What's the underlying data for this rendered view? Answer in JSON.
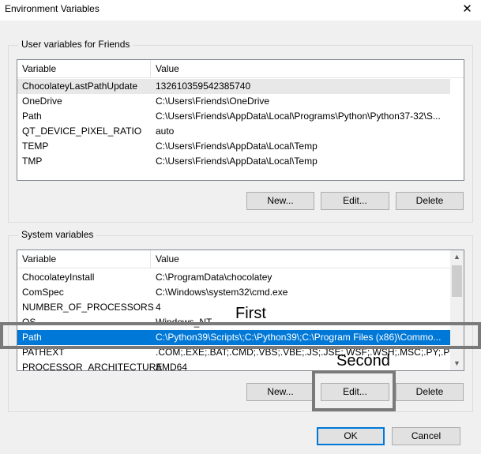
{
  "window": {
    "title": "Environment Variables",
    "close_glyph": "✕"
  },
  "user_vars": {
    "legend": "User variables for Friends",
    "headers": [
      "Variable",
      "Value"
    ],
    "rows": [
      [
        "ChocolateyLastPathUpdate",
        "132610359542385740"
      ],
      [
        "OneDrive",
        "C:\\Users\\Friends\\OneDrive"
      ],
      [
        "Path",
        "C:\\Users\\Friends\\AppData\\Local\\Programs\\Python\\Python37-32\\S..."
      ],
      [
        "QT_DEVICE_PIXEL_RATIO",
        "auto"
      ],
      [
        "TEMP",
        "C:\\Users\\Friends\\AppData\\Local\\Temp"
      ],
      [
        "TMP",
        "C:\\Users\\Friends\\AppData\\Local\\Temp"
      ]
    ],
    "buttons": {
      "new": "New...",
      "edit": "Edit...",
      "delete": "Delete"
    }
  },
  "system_vars": {
    "legend": "System variables",
    "headers": [
      "Variable",
      "Value"
    ],
    "rows": [
      [
        "ChocolateyInstall",
        "C:\\ProgramData\\chocolatey"
      ],
      [
        "ComSpec",
        "C:\\Windows\\system32\\cmd.exe"
      ],
      [
        "NUMBER_OF_PROCESSORS",
        "4"
      ],
      [
        "OS",
        "Windows_NT"
      ],
      [
        "Path",
        "C:\\Python39\\Scripts\\;C:\\Python39\\;C:\\Program Files (x86)\\Commo..."
      ],
      [
        "PATHEXT",
        ".COM;.EXE;.BAT;.CMD;.VBS;.VBE;.JS;.JSE;.WSF;.WSH;.MSC;.PY;.PYW"
      ],
      [
        "PROCESSOR_ARCHITECTURE",
        "AMD64"
      ]
    ],
    "selected_row": "Path",
    "buttons": {
      "new": "New...",
      "edit": "Edit...",
      "delete": "Delete"
    }
  },
  "dialog_buttons": {
    "ok": "OK",
    "cancel": "Cancel"
  },
  "annotations": {
    "first": "First",
    "second": "Second"
  },
  "colors": {
    "selection": "#0078d7",
    "annotation_border": "#7a7a7a"
  }
}
